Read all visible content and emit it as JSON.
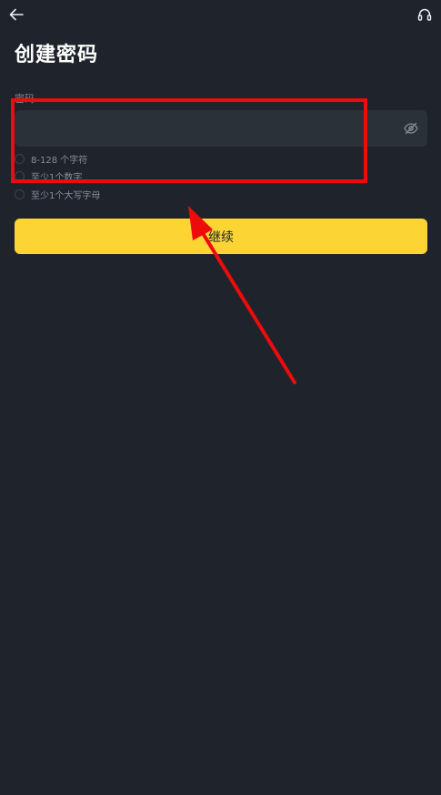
{
  "header": {
    "back_icon": "arrow-left-icon",
    "support_icon": "headset-icon"
  },
  "page": {
    "title": "创建密码"
  },
  "password": {
    "label": "密码",
    "value": "",
    "placeholder": "",
    "toggle_icon": "eye-off-icon"
  },
  "rules": [
    {
      "text": "8-128 个字符",
      "icon": "check-circle-icon"
    },
    {
      "text": "至少1个数字",
      "icon": "check-circle-icon"
    },
    {
      "text": "至少1个大写字母",
      "icon": "check-circle-icon"
    }
  ],
  "actions": {
    "continue_label": "继续"
  },
  "colors": {
    "background": "#1f232c",
    "input_bg": "#2b3139",
    "accent": "#fcd535",
    "muted_text": "#848e9c",
    "annotation": "#ee0b0b"
  }
}
